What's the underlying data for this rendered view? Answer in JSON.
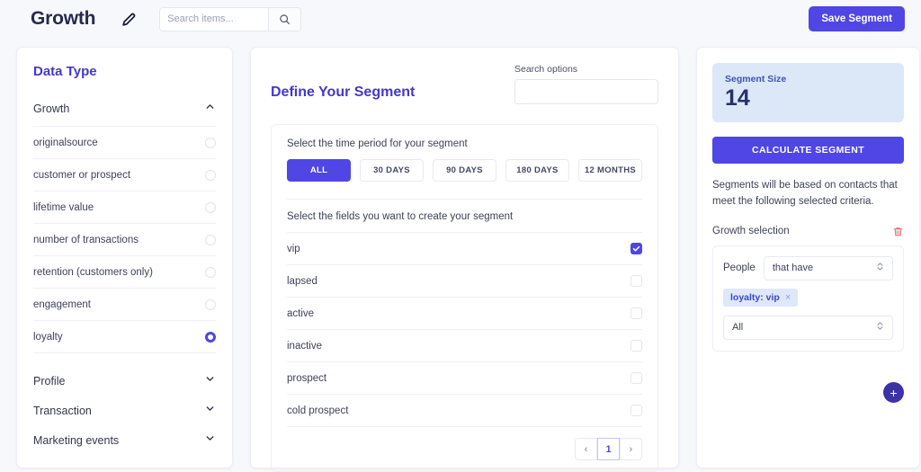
{
  "header": {
    "brand": "Growth",
    "edit_icon": "pencil-icon",
    "search_placeholder": "Search items...",
    "search_value": "",
    "search_icon": "search-icon",
    "save_label": "Save Segment"
  },
  "sidebar": {
    "title": "Data Type",
    "expanded_group": {
      "label": "Growth",
      "chevron": "chevron-up-icon",
      "options": [
        {
          "label": "originalsource",
          "selected": false
        },
        {
          "label": "customer or prospect",
          "selected": false
        },
        {
          "label": "lifetime value",
          "selected": false
        },
        {
          "label": "number of transactions",
          "selected": false
        },
        {
          "label": "retention (customers only)",
          "selected": false
        },
        {
          "label": "engagement",
          "selected": false
        },
        {
          "label": "loyalty",
          "selected": true
        }
      ]
    },
    "collapsed_groups": [
      {
        "label": "Profile",
        "chevron": "chevron-down-icon"
      },
      {
        "label": "Transaction",
        "chevron": "chevron-down-icon"
      },
      {
        "label": "Marketing events",
        "chevron": "chevron-down-icon"
      }
    ]
  },
  "center": {
    "title": "Define Your Segment",
    "search_options_label": "Search options",
    "search_options_value": "",
    "search_options_placeholder": "",
    "time_period_label": "Select the time period for your segment",
    "time_periods": [
      {
        "label": "ALL",
        "active": true
      },
      {
        "label": "30 DAYS",
        "active": false
      },
      {
        "label": "90 DAYS",
        "active": false
      },
      {
        "label": "180 DAYS",
        "active": false
      },
      {
        "label": "12 MONTHS",
        "active": false
      }
    ],
    "fields_label": "Select the fields you want to create your segment",
    "fields": [
      {
        "label": "vip",
        "checked": true
      },
      {
        "label": "lapsed",
        "checked": false
      },
      {
        "label": "active",
        "checked": false
      },
      {
        "label": "inactive",
        "checked": false
      },
      {
        "label": "prospect",
        "checked": false
      },
      {
        "label": "cold prospect",
        "checked": false
      }
    ],
    "pagination": {
      "prev": "‹",
      "current": "1",
      "next": "›"
    }
  },
  "right": {
    "segment_size_label": "Segment Size",
    "segment_size_value": "14",
    "calculate_label": "CALCULATE SEGMENT",
    "criteria_text": "Segments will be based on contacts that meet the following selected criteria.",
    "selection_title": "Growth selection",
    "delete_icon": "trash-icon",
    "people_label": "People",
    "condition_value": "that have",
    "chip_label": "loyalty: vip",
    "chip_remove": "×",
    "scope_value": "All",
    "add_label": "+"
  },
  "colors": {
    "accent": "#4f46e5",
    "accent_dark": "#3b32a8",
    "title_purple": "#4338ca",
    "segment_card_bg": "#dce8f8",
    "segment_value": "#26306b",
    "chip_bg": "#dfe7fb",
    "chip_text": "#3949c9",
    "danger": "#e57373",
    "page_bg": "#f7f8fc"
  }
}
